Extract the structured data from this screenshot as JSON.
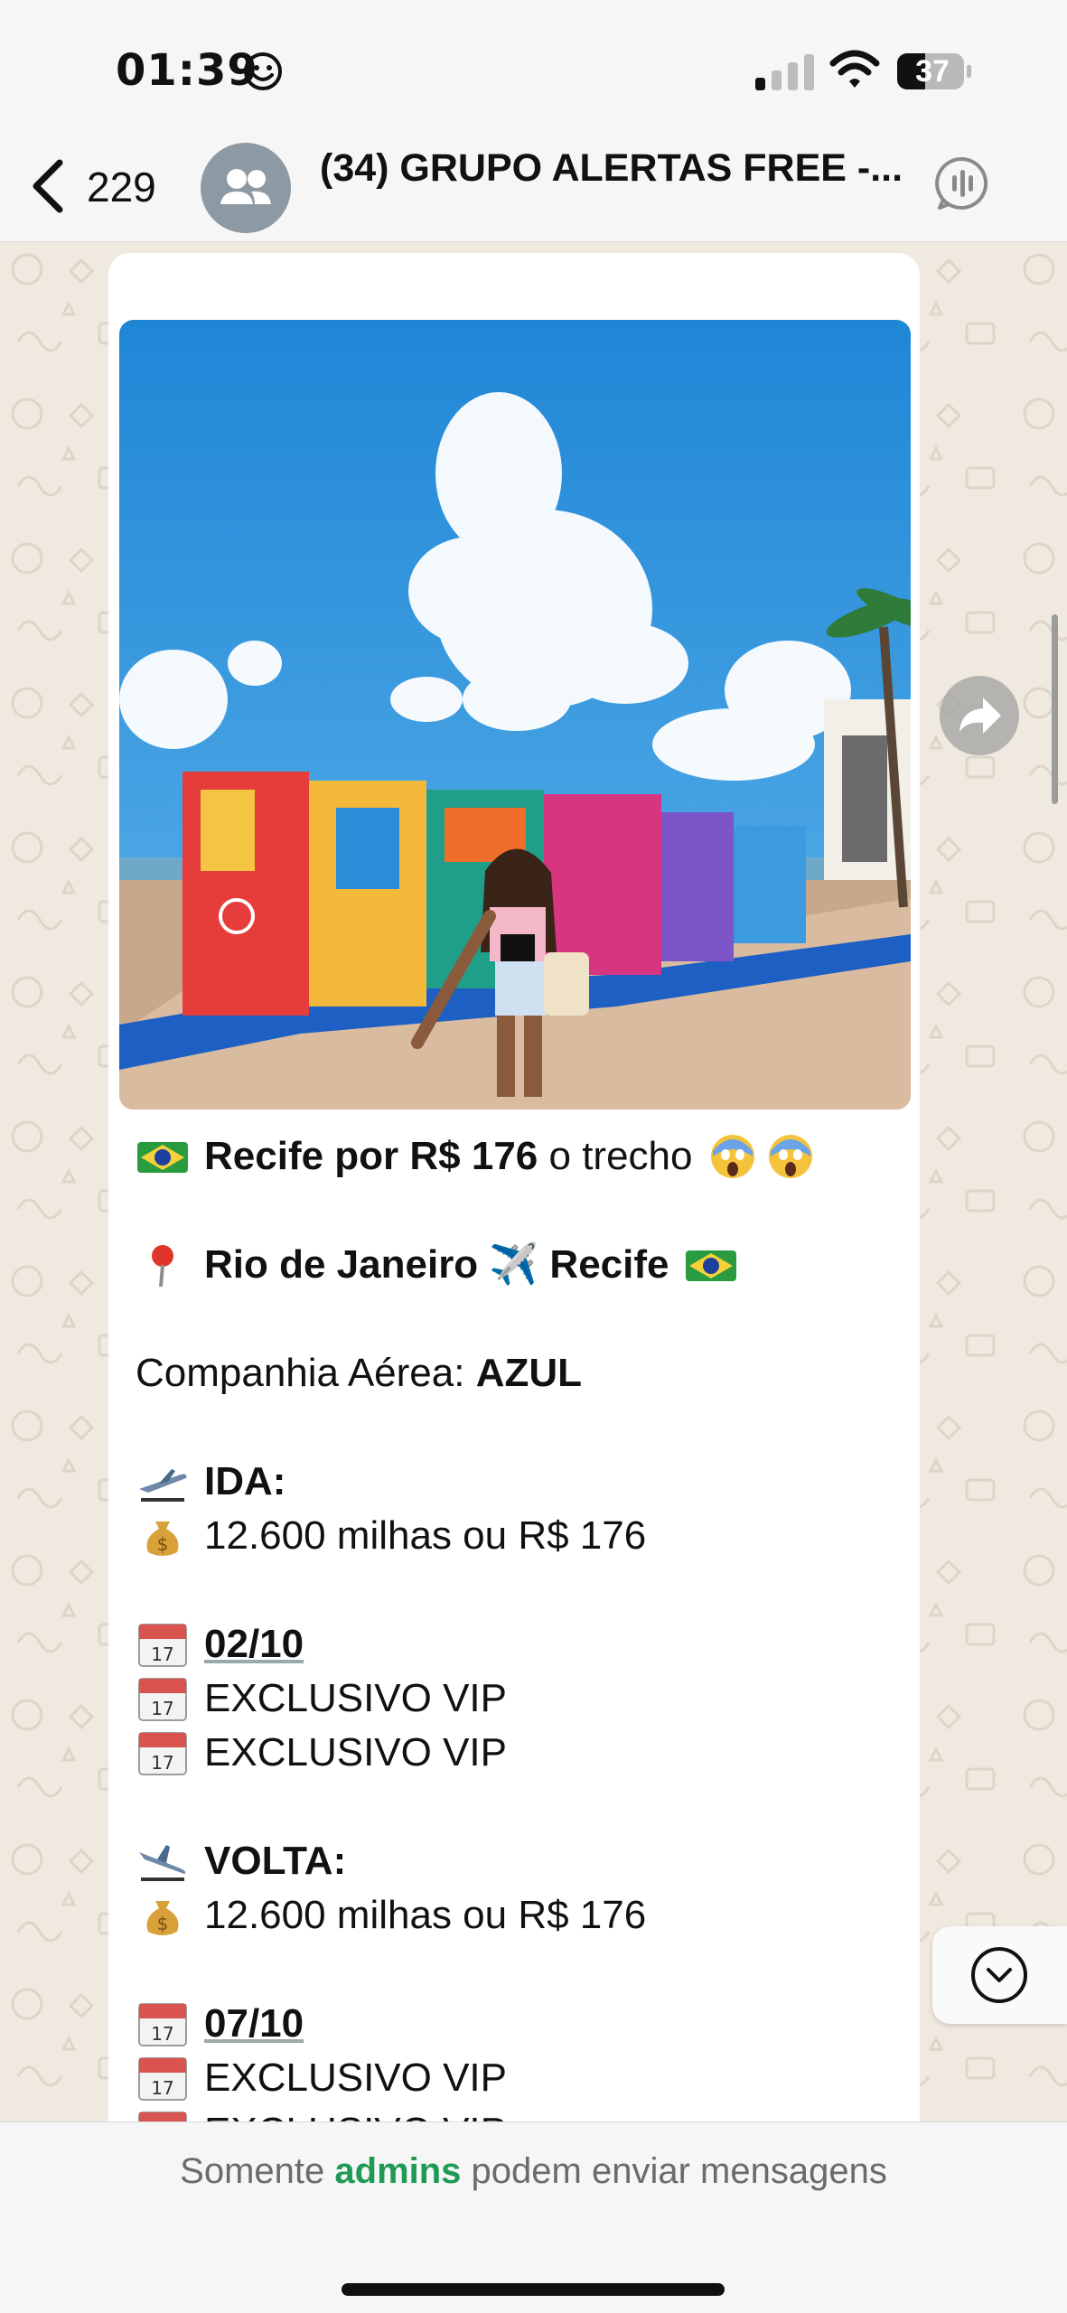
{
  "status": {
    "time": "01:39",
    "battery": "37"
  },
  "header": {
    "back_count": "229",
    "title": "(34) GRUPO ALERTAS FREE -..."
  },
  "message": {
    "lines": {
      "title_bold": "Recife por R$ 176",
      "title_rest": " o trecho",
      "route": "Rio de Janeiro ✈️ Recife",
      "airline_label": "Companhia Aérea: ",
      "airline": "AZUL",
      "ida_label": "IDA:",
      "ida_price": "12.600 milhas ou R$ 176",
      "ida_date": "02/10",
      "ida_vip1": "EXCLUSIVO VIP",
      "ida_vip2": "EXCLUSIVO VIP",
      "volta_label": "VOLTA:",
      "volta_price": "12.600 milhas ou R$ 176",
      "volta_date": "07/10",
      "volta_vip1": "EXCLUSIVO VIP",
      "volta_vip2": "EXCLUSIVO VIP"
    }
  },
  "footer": {
    "prefix": "Somente ",
    "admins": "admins",
    "suffix": " podem enviar mensagens"
  },
  "icons": [
    "back-chevron-icon",
    "group-avatar-icon",
    "voice-chat-icon",
    "forward-icon",
    "chevron-down-icon",
    "brazil-flag-icon",
    "pin-icon",
    "airplane-icon",
    "money-bag-icon",
    "calendar-icon",
    "scream-face-icon"
  ],
  "colors": {
    "accent_green": "#1e9a55",
    "bubble": "#ffffff",
    "wallpaper": "#efe9df"
  }
}
